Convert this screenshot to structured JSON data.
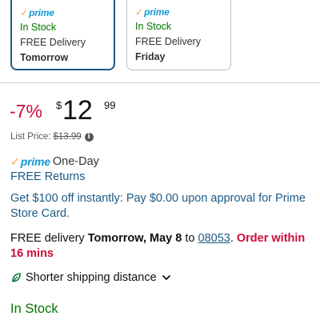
{
  "delivery_options": [
    {
      "prime_check": "✓",
      "prime_label": "prime",
      "stock": "In Stock",
      "delivery": "FREE Delivery",
      "day": "Tomorrow",
      "selected": true
    },
    {
      "prime_check": "✓",
      "prime_label": "prime",
      "stock": "In Stock",
      "delivery": "FREE Delivery",
      "day": "Friday",
      "selected": false
    }
  ],
  "price": {
    "discount": "-7%",
    "currency": "$",
    "whole": "12",
    "fraction": "99",
    "list_price_label": "List Price:",
    "list_price_value": "$13.99",
    "info_icon": "i"
  },
  "prime_shipping": {
    "check": "✓",
    "label": "prime",
    "speed": "One-Day",
    "returns": "FREE Returns"
  },
  "promo": {
    "text": "Get $100 off instantly: Pay $0.00 upon approval for Prime Store Card."
  },
  "delivery": {
    "prefix": "FREE delivery ",
    "date": "Tomorrow, May 8",
    "to": " to ",
    "zip": "08053",
    "period": ". ",
    "order_within": "Order within 16 mins"
  },
  "sustainability": {
    "label": "Shorter shipping distance",
    "icon": "leaf-icon",
    "toggle_icon": "chevron-down-icon"
  },
  "availability": "In Stock",
  "colors": {
    "discount_red": "#cc0c39",
    "link_blue": "#1b5a84",
    "stock_green": "#007600",
    "prime_blue": "#1399d6",
    "prime_orange": "#f3a847",
    "selected_border": "#1b5a84"
  }
}
